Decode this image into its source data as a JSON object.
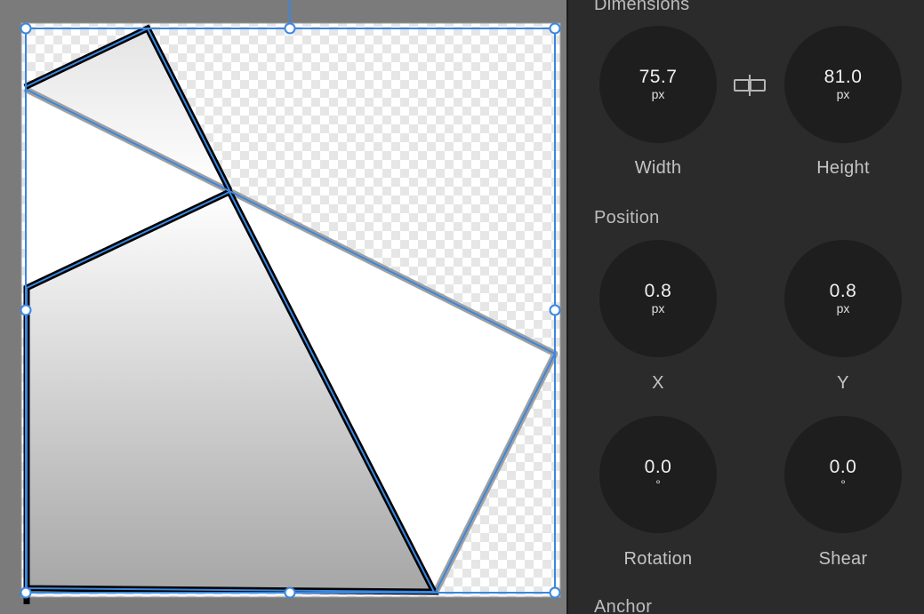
{
  "inspector": {
    "dimensions": {
      "title": "Dimensions",
      "width": {
        "value": "75.7",
        "unit": "px",
        "label": "Width"
      },
      "height": {
        "value": "81.0",
        "unit": "px",
        "label": "Height"
      },
      "link_icon": "link-proportions-icon"
    },
    "position": {
      "title": "Position",
      "x": {
        "value": "0.8",
        "unit": "px",
        "label": "X"
      },
      "y": {
        "value": "0.8",
        "unit": "px",
        "label": "Y"
      }
    },
    "transform": {
      "rotation": {
        "value": "0.0",
        "unit": "°",
        "label": "Rotation"
      },
      "shear": {
        "value": "0.0",
        "unit": "°",
        "label": "Shear"
      }
    },
    "anchor": {
      "title": "Anchor"
    }
  },
  "colors": {
    "selection": "#3a87e0",
    "canvas_bg": "#7b7b7b",
    "panel_bg": "#2b2b2b",
    "dial_bg": "#1e1e1e"
  }
}
